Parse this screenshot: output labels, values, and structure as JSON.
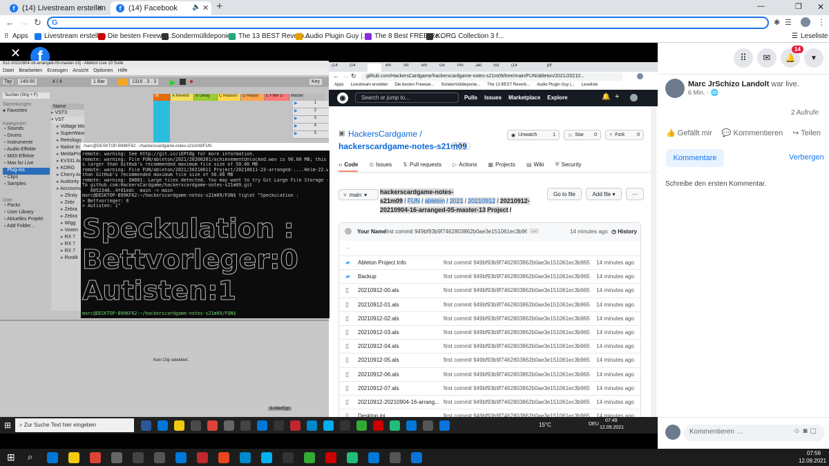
{
  "outer_tabs": [
    {
      "label": "(14) Livestream erstellen | Facebo",
      "active": false
    },
    {
      "label": "(14) Facebook",
      "active": true
    }
  ],
  "outer_address": "G",
  "outer_bookmarks": [
    {
      "label": "Apps",
      "color": "#666"
    },
    {
      "label": "Livestream erstellen",
      "color": "#1877f2"
    },
    {
      "label": "Die besten Freewar...",
      "color": "#c00"
    },
    {
      "label": "Sondermülldeponie...",
      "color": "#333"
    },
    {
      "label": "The 13 BEST Reverb...",
      "color": "#2a7"
    },
    {
      "label": "Audio Plugin Guy |...",
      "color": "#e8a000"
    },
    {
      "label": "The 8 Best FREE Re...",
      "color": "#8a2be2"
    },
    {
      "label": "KORG Collection 3 f...",
      "color": "#333"
    }
  ],
  "reading_list": "Leseliste",
  "fb": {
    "notif_count": "14",
    "user": "Marc JrSchizo Landolt",
    "action": "war live.",
    "time": "6 Min. ·",
    "views": "2 Aufrufe",
    "like": "Gefällt mir",
    "comment": "Kommentieren",
    "share": "Teilen",
    "comments_tab": "Kommentare",
    "hide": "Verbergen",
    "prompt": "Schreibe den ersten Kommentar.",
    "input_placeholder": "Kommentieren …"
  },
  "ableton": {
    "title": "912-20210904-16-arranged-05-master-13] - Ableton Live 10 Suite",
    "menu": [
      "Datei",
      "Bearbeiten",
      "Erzeugen",
      "Ansicht",
      "Optionen",
      "Hilfe"
    ],
    "tempo": "149.00",
    "sig": "4 / 4",
    "bar": "1 Bar",
    "pos": "1316 . 3 . 3",
    "key": "Key",
    "search": "Suchen (Strg + F)",
    "sammlungen": "Sammlungen",
    "favoriten": "Favoriten",
    "kategorien": "Kategorien",
    "categories": [
      "Sounds",
      "Drums",
      "Instrumente",
      "Audio-Effekte",
      "MIDI-Effekte",
      "Max for Live",
      "Plug-ins",
      "Clips",
      "Samples"
    ],
    "orte": "Orte",
    "places": [
      "Packs",
      "User Library",
      "Aktuelles Projekt",
      "Add Folder..."
    ],
    "name_header": "Name",
    "plugins": [
      "VST3",
      "VST",
      "Voltage Modular",
      "SuperWave",
      "Retrologu",
      "Native In",
      "MeldaPro",
      "KV331 Au",
      "KORG",
      "Cherry Au",
      "Audiority",
      "Accusonu",
      "Zfinity",
      "Zebr",
      "Zebra",
      "Zebra",
      "Wigg",
      "Voxen",
      "RX 7",
      "RX 7",
      "RX 7",
      "Rustik"
    ],
    "tracks": [
      "A Reverb",
      "B Delay",
      "C Reason",
      "D Reaso",
      "E Filter D",
      "Master"
    ],
    "master_nums": [
      "1",
      "2",
      "3",
      "4",
      "5"
    ],
    "no_clip": "Kein Clip selektiert.",
    "bottom_track": "9-AlterEgo"
  },
  "terminal": {
    "title": "marc@DESKTOP-B99KF62: ~/hackerscardgame-notes-s21m09/FUN",
    "lines": [
      "remote: warning: See http://git.io/iEPt8g for more information.",
      "remote: warning: File FUN/ableton/2021/20200201/achievementUnlocked.wav is 90.00 MB; this i",
      "s larger than GitHub's recommended maximum file size of 50.00 MB",
      "remote: warning: File FUN/ableton/2021/20210611 Project/20210611-23-arranged-....Helm-22.w",
      "than GitHub's recommended maximum file size of 50.00 MB",
      "remote: warning: GH001: Large files detected. You may want to try Git Large File Storage -",
      "To github.com:HackersCardgame/hackerscardgame-notes-s21m09.git",
      "   6052348..4f01edc  main -> main",
      "marc@DESKTOP-B99KF62:~/hackerscardgame-notes-s21m09/FUN$ figlet \"Speckulation :",
      "> Bettvorleger: 0",
      "> Autisten: 1\""
    ],
    "figlet": [
      "Speckulation :",
      "Bettvorleger:0",
      "Autisten:1"
    ],
    "prompt": "marc@DESKTOP-B99KF62:~/hackerscardgame-notes-s21m09/FUN$"
  },
  "gh": {
    "url": "github.com/HackersCardgame/hackerscardgame-notes-s21m09/tree/main/FUN/ableton/2021/20210...",
    "bookmarks": [
      "Apps",
      "Livestream erstellen",
      "Die besten Freewar...",
      "Sondermülldeponie...",
      "The 13 BEST Reverb...",
      "Audio Plugin Guy |...",
      "Leseliste"
    ],
    "search": "Search or jump to...",
    "nav": [
      "Pulls",
      "Issues",
      "Marketplace",
      "Explore"
    ],
    "owner": "HackersCardgame /",
    "repo": "hackerscardgame-notes-s21m09",
    "public": "Public",
    "unwatch": "Unwatch",
    "unwatch_n": "1",
    "star": "Star",
    "star_n": "0",
    "fork": "Fork",
    "fork_n": "0",
    "tabs": [
      "Code",
      "Issues",
      "Pull requests",
      "Actions",
      "Projects",
      "Wiki",
      "Security"
    ],
    "branch": "main",
    "crumb": [
      "hackerscardgame-notes-s21m09",
      "/",
      "FUN",
      "/",
      "ableton",
      "/",
      "2021",
      "/",
      "20210912",
      "/",
      "20210912-20210904-16-arranged-05-master-13",
      "Project",
      "/"
    ],
    "goto": "Go to file",
    "addfile": "Add file",
    "commit_user": "Your Name",
    "commit_msg": "first commit 949bf93b9f7462803862b0ae3e151061ec3b965a",
    "commit_time": "14 minutes ago",
    "history": "History",
    "parent": "..",
    "rows": [
      {
        "name": "Ableton Project Info",
        "dir": true
      },
      {
        "name": "Backup",
        "dir": true
      },
      {
        "name": "20210912-00.als",
        "dir": false
      },
      {
        "name": "20210912-01.als",
        "dir": false
      },
      {
        "name": "20210912-02.als",
        "dir": false
      },
      {
        "name": "20210912-03.als",
        "dir": false
      },
      {
        "name": "20210912-04.als",
        "dir": false
      },
      {
        "name": "20210912-05.als",
        "dir": false
      },
      {
        "name": "20210912-06.als",
        "dir": false
      },
      {
        "name": "20210912-07.als",
        "dir": false
      },
      {
        "name": "20210912-20210904-16-arrang...",
        "dir": false
      },
      {
        "name": "Desktop.ini",
        "dir": false
      }
    ],
    "row_msg": "first commit 949bf93b9f7462803862b0ae3e151061ec3b965a",
    "row_time": "14 minutes ago"
  },
  "inner_taskbar": {
    "search": "Zur Suche Text hier eingeben",
    "weather": "15°C",
    "lang": "DEU",
    "time": "07:49",
    "date": "12.09.2021"
  },
  "outer_taskbar": {
    "time": "07:56",
    "date": "12.09.2021"
  }
}
